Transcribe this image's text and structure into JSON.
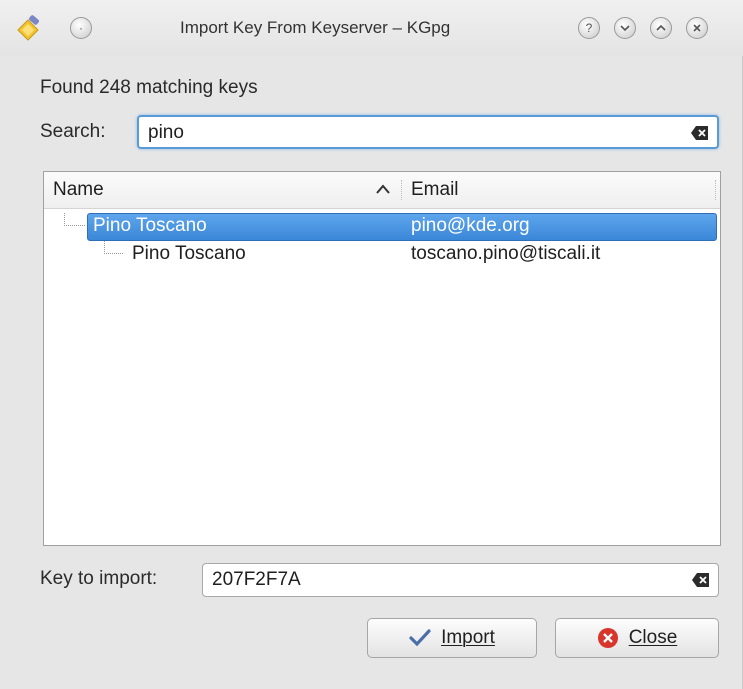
{
  "window": {
    "title": "Import Key From Keyserver – KGpg"
  },
  "status": {
    "found_text": "Found 248 matching keys"
  },
  "search": {
    "label": "Search:",
    "value": "pino"
  },
  "tree": {
    "columns": [
      "Name",
      "Email"
    ],
    "sort_column": "Name",
    "rows": [
      {
        "name": "Pino Toscano",
        "email": "pino@kde.org",
        "selected": true,
        "level": 0
      },
      {
        "name": "Pino Toscano",
        "email": "toscano.pino@tiscali.it",
        "selected": false,
        "level": 1
      }
    ]
  },
  "key_import": {
    "label": "Key to import:",
    "value": "207F2F7A"
  },
  "buttons": {
    "import_label": "Import",
    "close_label": "Close"
  },
  "colors": {
    "selection": "#3a86d8",
    "focus_border": "#5b9bd5",
    "close_icon": "#d9362b"
  },
  "icons": {
    "app": "kgpg-key-icon",
    "clear": "clear-text-icon",
    "import": "checkmark-icon",
    "close": "close-circle-icon"
  }
}
